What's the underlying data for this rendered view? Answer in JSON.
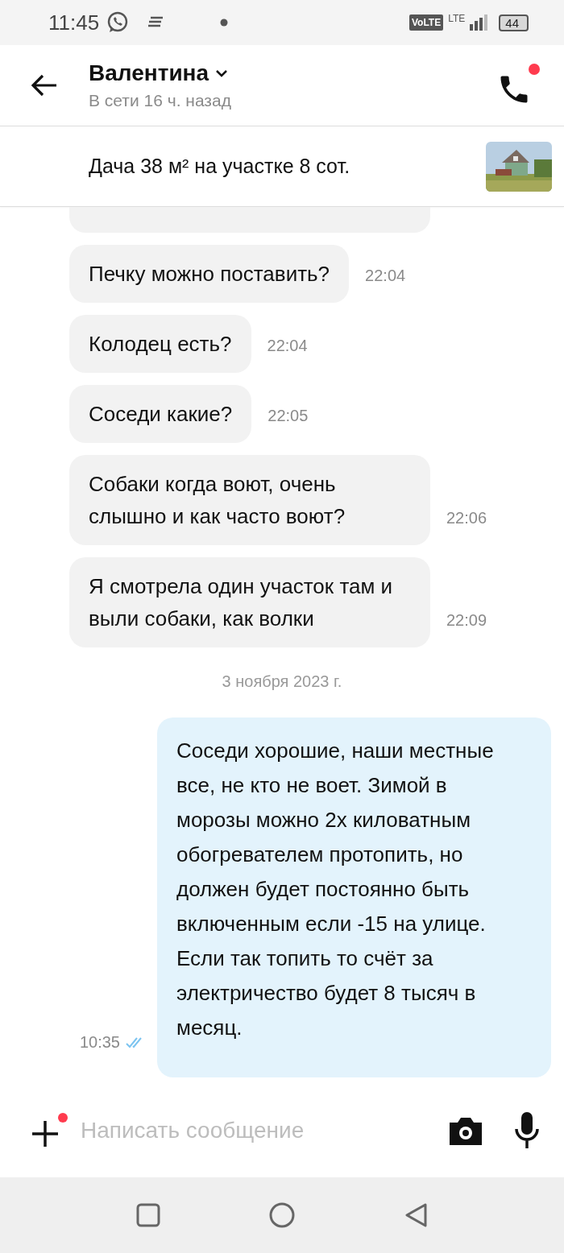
{
  "status_bar": {
    "time": "11:45",
    "volte": "VoLTE",
    "network": "LTE",
    "battery": "44"
  },
  "header": {
    "name": "Валентина",
    "presence": "В сети 16 ч. назад",
    "call_badge": true
  },
  "listing": {
    "title": "Дача 38 м² на участке 8 сот."
  },
  "messages": [
    {
      "kind": "partial"
    },
    {
      "kind": "incoming",
      "text": "Печку можно поставить?",
      "time": "22:04"
    },
    {
      "kind": "incoming",
      "text": "Колодец есть?",
      "time": "22:04"
    },
    {
      "kind": "incoming",
      "text": "Соседи какие?",
      "time": "22:05"
    },
    {
      "kind": "incoming",
      "text": "Собаки когда воют, очень слышно и как часто воют?",
      "time": "22:06"
    },
    {
      "kind": "incoming",
      "text": "Я смотрела один участок там и выли собаки, как волки",
      "time": "22:09"
    },
    {
      "kind": "date",
      "text": "3 ноября 2023 г."
    },
    {
      "kind": "outgoing",
      "text": "Соседи хорошие, наши местные все, не кто не воет. Зимой в морозы можно 2х киловатным обогревателем протопить, но должен будет постоянно быть включенным если -15 на улице. Если так топить то счёт за электричество будет 8 тысяч в месяц.",
      "time": "10:35",
      "read": true
    }
  ],
  "composer": {
    "placeholder": "Написать сообщение",
    "attach_badge": true
  }
}
